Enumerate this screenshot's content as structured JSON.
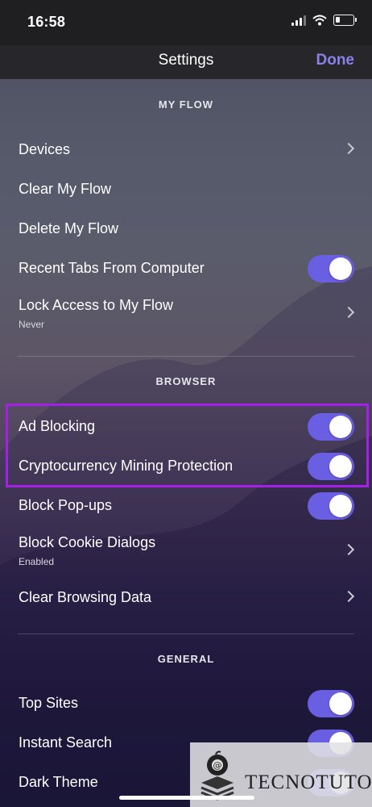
{
  "status_bar": {
    "time": "16:58"
  },
  "nav": {
    "title": "Settings",
    "done_label": "Done"
  },
  "sections": {
    "my_flow": {
      "header": "MY FLOW",
      "devices": "Devices",
      "clear": "Clear My Flow",
      "delete": "Delete My Flow",
      "recent_tabs": {
        "label": "Recent Tabs From Computer",
        "on": true
      },
      "lock_access": {
        "label": "Lock Access to My Flow",
        "value": "Never"
      }
    },
    "browser": {
      "header": "BROWSER",
      "ad_blocking": {
        "label": "Ad Blocking",
        "on": true
      },
      "crypto": {
        "label": "Cryptocurrency Mining Protection",
        "on": true
      },
      "popups": {
        "label": "Block Pop-ups",
        "on": true
      },
      "cookie": {
        "label": "Block Cookie Dialogs",
        "value": "Enabled"
      },
      "clear_data": "Clear Browsing Data"
    },
    "general": {
      "header": "GENERAL",
      "top_sites": {
        "label": "Top Sites",
        "on": true
      },
      "instant_search": {
        "label": "Instant Search",
        "on": true
      },
      "dark_theme": {
        "label": "Dark Theme",
        "on": true
      }
    }
  },
  "colors": {
    "accent": "#6a5ee2",
    "done": "#8b80e8",
    "highlight": "#a51fe8"
  },
  "watermark": {
    "text": "TECNOTUTO"
  }
}
